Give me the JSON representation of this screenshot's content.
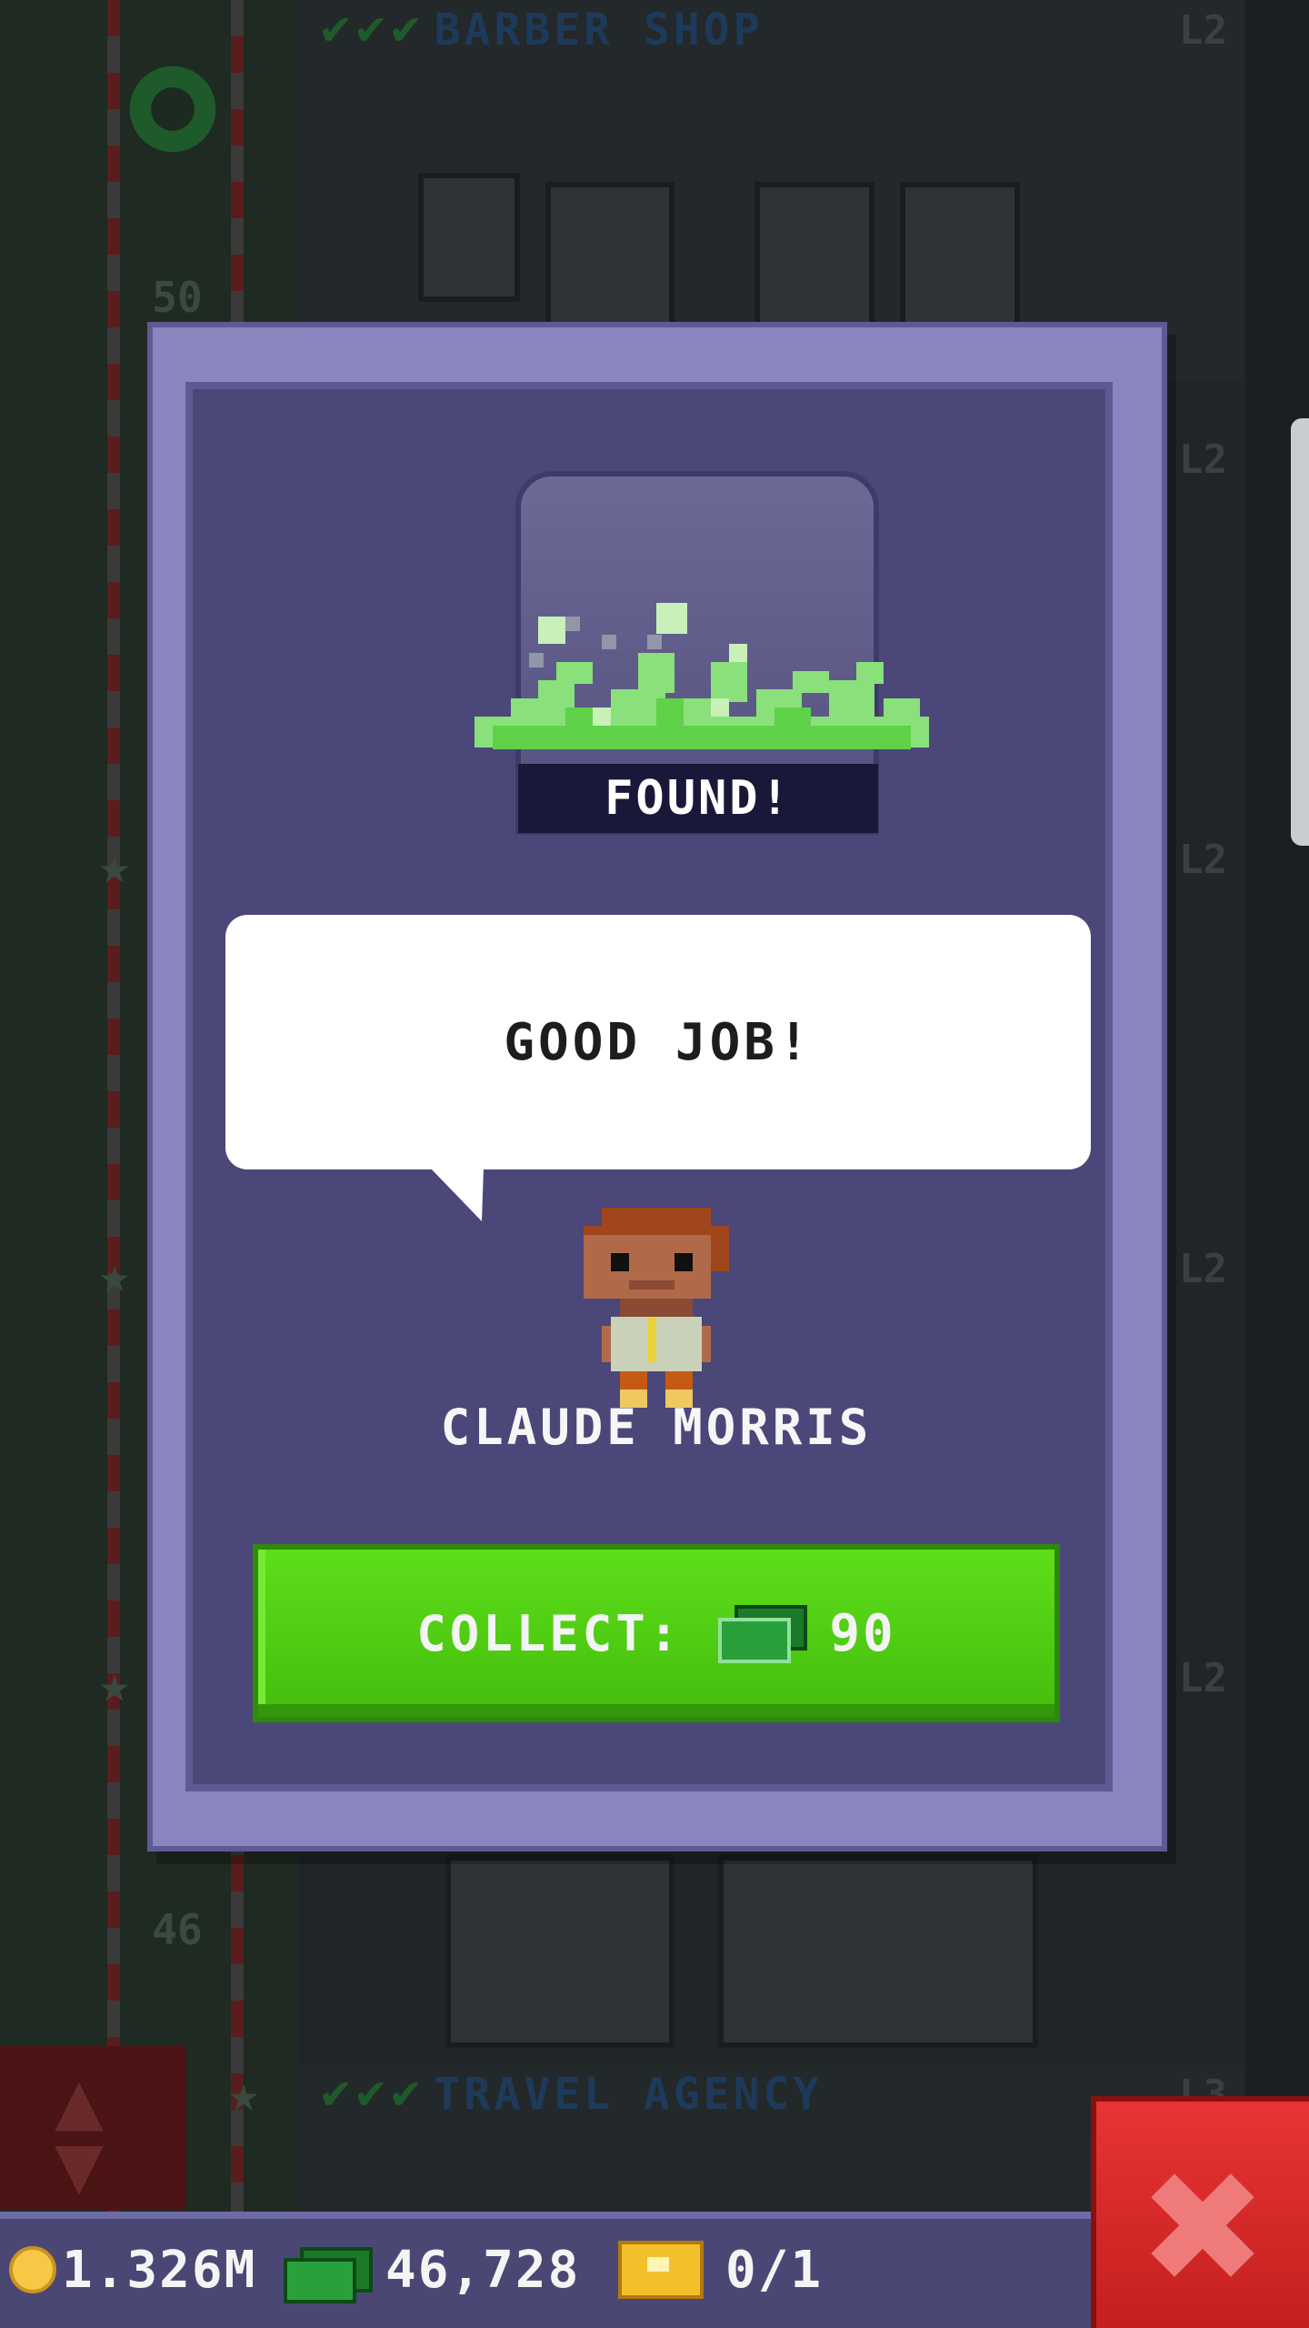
{
  "background": {
    "floors": [
      {
        "name": "BARBER SHOP",
        "level": "L2"
      },
      {
        "name": "TRAVEL AGENCY",
        "level": "L3"
      }
    ],
    "side_levels": [
      "L2",
      "L2",
      "L2",
      "L2"
    ],
    "floor_numbers": [
      "50",
      "46"
    ]
  },
  "modal": {
    "banner": "FOUND!",
    "speech": "GOOD JOB!",
    "character_name": "CLAUDE MORRIS",
    "collect": {
      "label": "COLLECT:",
      "currency_icon": "bux-icon",
      "amount": "90"
    }
  },
  "status_bar": {
    "coins": "1.326M",
    "bux": "46,728",
    "tickets": "0/1"
  },
  "close_button": {
    "icon": "close-icon"
  },
  "colors": {
    "modal_frame": "#8a84bf",
    "modal_inner": "#4b4778",
    "collect_green": "#4fcf12",
    "close_red": "#d42828"
  }
}
